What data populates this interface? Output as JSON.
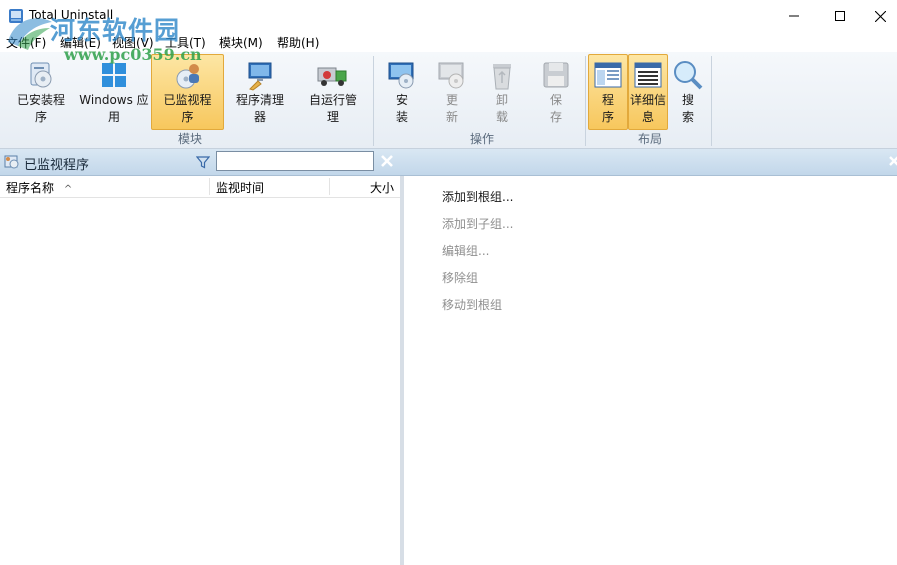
{
  "window": {
    "title": "Total Uninstall"
  },
  "watermark": {
    "text": "河东软件园",
    "url": "www.pc0359.cn"
  },
  "menu": [
    "文件(F)",
    "编辑(E)",
    "视图(V)",
    "工具(T)",
    "模块(M)",
    "帮助(H)"
  ],
  "ribbon": {
    "groups": {
      "modules": "模块",
      "actions": "操作",
      "layout": "布局"
    },
    "buttons": {
      "installed": [
        "已安装程",
        "序"
      ],
      "windows_apps": [
        "Windows 应",
        "用"
      ],
      "monitored": [
        "已监视程",
        "序"
      ],
      "cleaner": [
        "程序清理",
        "器"
      ],
      "autorun": [
        "自运行管",
        "理"
      ],
      "install": [
        "安",
        "装"
      ],
      "update": [
        "更",
        "新"
      ],
      "uninstall": [
        "卸",
        "载"
      ],
      "save": [
        "保",
        "存"
      ],
      "program": [
        "程",
        "序"
      ],
      "details": [
        "详细信",
        "息"
      ],
      "search": [
        "搜",
        "索"
      ]
    }
  },
  "panel": {
    "title": "已监视程序",
    "search_placeholder": ""
  },
  "list": {
    "columns": {
      "name": "程序名称",
      "time": "监视时间",
      "size": "大小"
    },
    "sort_indicator": "^"
  },
  "group_menu": [
    {
      "label": "添加到根组...",
      "enabled": true
    },
    {
      "label": "添加到子组...",
      "enabled": false
    },
    {
      "label": "编辑组...",
      "enabled": false
    },
    {
      "label": "移除组",
      "enabled": false
    },
    {
      "label": "移动到根组",
      "enabled": false
    }
  ]
}
